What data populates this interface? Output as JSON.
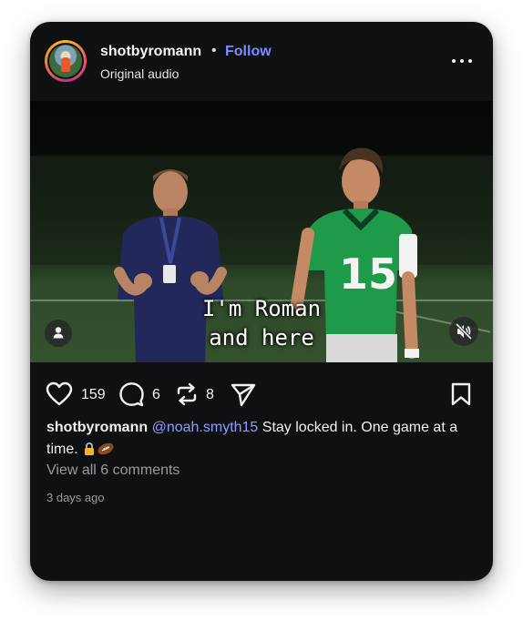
{
  "post": {
    "username": "shotbyromann",
    "separator": "•",
    "follow_label": "Follow",
    "audio_label": "Original audio",
    "more_icon": "more-horizontal-icon"
  },
  "media": {
    "caption_line1": "I'm Roman",
    "caption_line2": "and here",
    "user_tag_icon": "person-icon",
    "mute_icon": "speaker-muted-icon"
  },
  "actions": {
    "likes": "159",
    "comments": "6",
    "reposts": "8",
    "icons": [
      "heart-icon",
      "comment-icon",
      "repost-icon",
      "share-icon",
      "bookmark-icon"
    ]
  },
  "caption": {
    "user": "shotbyromann",
    "mention": "@noah.smyth15",
    "text": " Stay locked in. One game at a time. ",
    "emojis": [
      "lock-emoji",
      "football-emoji"
    ]
  },
  "comments_link": "View all 6 comments",
  "timestamp": "3 days ago",
  "colors": {
    "card_bg": "#0f1012",
    "follow": "#7b8cff",
    "mention": "#8e9cff",
    "muted_text": "#9a9a9a"
  }
}
